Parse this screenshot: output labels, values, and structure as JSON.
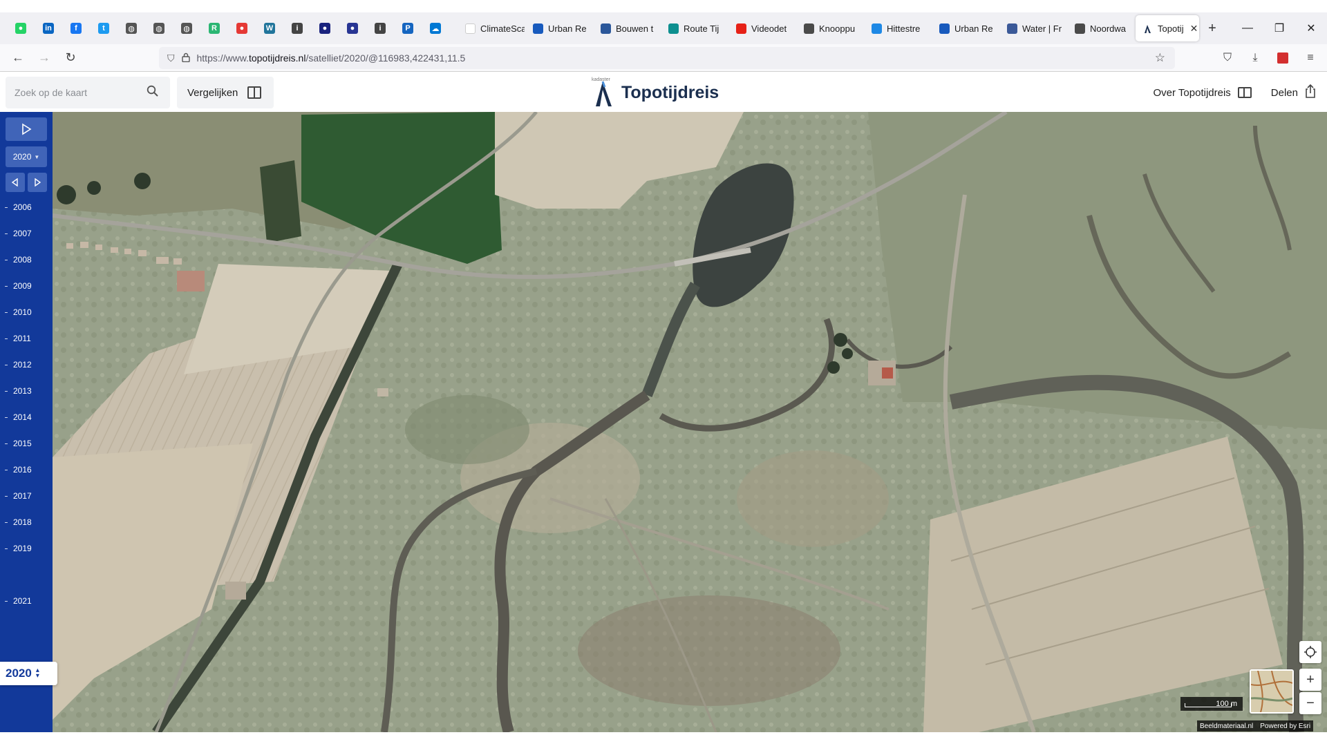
{
  "browser": {
    "pinned_tabs": [
      {
        "icon": "whatsapp-icon",
        "color": "#25d366",
        "glyph": "●"
      },
      {
        "icon": "linkedin-icon",
        "color": "#0a66c2",
        "glyph": "in"
      },
      {
        "icon": "facebook-icon",
        "color": "#1877f2",
        "glyph": "f"
      },
      {
        "icon": "twitter-icon",
        "color": "#1d9bf0",
        "glyph": "t"
      },
      {
        "icon": "globe-icon",
        "color": "#555555",
        "glyph": "◍"
      },
      {
        "icon": "globe-icon",
        "color": "#555555",
        "glyph": "◍"
      },
      {
        "icon": "globe-icon",
        "color": "#555555",
        "glyph": "◍"
      },
      {
        "icon": "app-icon",
        "color": "#2bb673",
        "glyph": "R"
      },
      {
        "icon": "notification-icon",
        "color": "#e53935",
        "glyph": "●"
      },
      {
        "icon": "wordpress-icon",
        "color": "#21759b",
        "glyph": "W"
      },
      {
        "icon": "info-icon",
        "color": "#444444",
        "glyph": "i"
      },
      {
        "icon": "app-icon",
        "color": "#1a237e",
        "glyph": "●"
      },
      {
        "icon": "app-icon",
        "color": "#283593",
        "glyph": "●"
      },
      {
        "icon": "info-icon",
        "color": "#444444",
        "glyph": "i"
      },
      {
        "icon": "parking-icon",
        "color": "#1565c0",
        "glyph": "P"
      },
      {
        "icon": "cloud-icon",
        "color": "#0078d4",
        "glyph": "☁"
      }
    ],
    "tabs": [
      {
        "label": "ClimateScan -",
        "color": "#ffffff",
        "width": 96
      },
      {
        "label": "Urban Re",
        "color": "#185abd",
        "width": 96
      },
      {
        "label": "Bouwen t",
        "color": "#2b579a",
        "width": 96
      },
      {
        "label": "Route Tij",
        "color": "#0d8f8f",
        "width": 96
      },
      {
        "label": "Videodet",
        "color": "#e62117",
        "width": 96
      },
      {
        "label": "Knooppu",
        "color": "#4a4a4a",
        "width": 96
      },
      {
        "label": "Hittestre",
        "color": "#1e88e5",
        "width": 96
      },
      {
        "label": "Urban Re",
        "color": "#185abd",
        "width": 96
      },
      {
        "label": "Water | Fr",
        "color": "#3b5998",
        "width": 96
      },
      {
        "label": "Noordwa",
        "color": "#4a4a4a",
        "width": 96
      }
    ],
    "active_tab": {
      "label": "Topotij",
      "color": "#1b2f4f"
    },
    "url_prefix": "https://www.",
    "url_domain": "topotijdreis.nl",
    "url_path": "/satelliet/2020/@116983,422431,11.5"
  },
  "header": {
    "search_placeholder": "Zoek op de kaart",
    "compare_label": "Vergelijken",
    "kadaster": "kadaster",
    "title": "Topotijdreis",
    "about_label": "Over Topotijdreis",
    "share_label": "Delen"
  },
  "timeline": {
    "selected_year": "2020",
    "years": [
      "2006",
      "2007",
      "2008",
      "2009",
      "2010",
      "2011",
      "2012",
      "2013",
      "2014",
      "2015",
      "2016",
      "2017",
      "2018",
      "2019",
      "2021"
    ],
    "current_year": "2020",
    "accent": "#12399a"
  },
  "map": {
    "scale_label": "100 m",
    "attribution_left": "Beeldmateriaal.nl",
    "attribution_right": "Powered by Esri"
  }
}
